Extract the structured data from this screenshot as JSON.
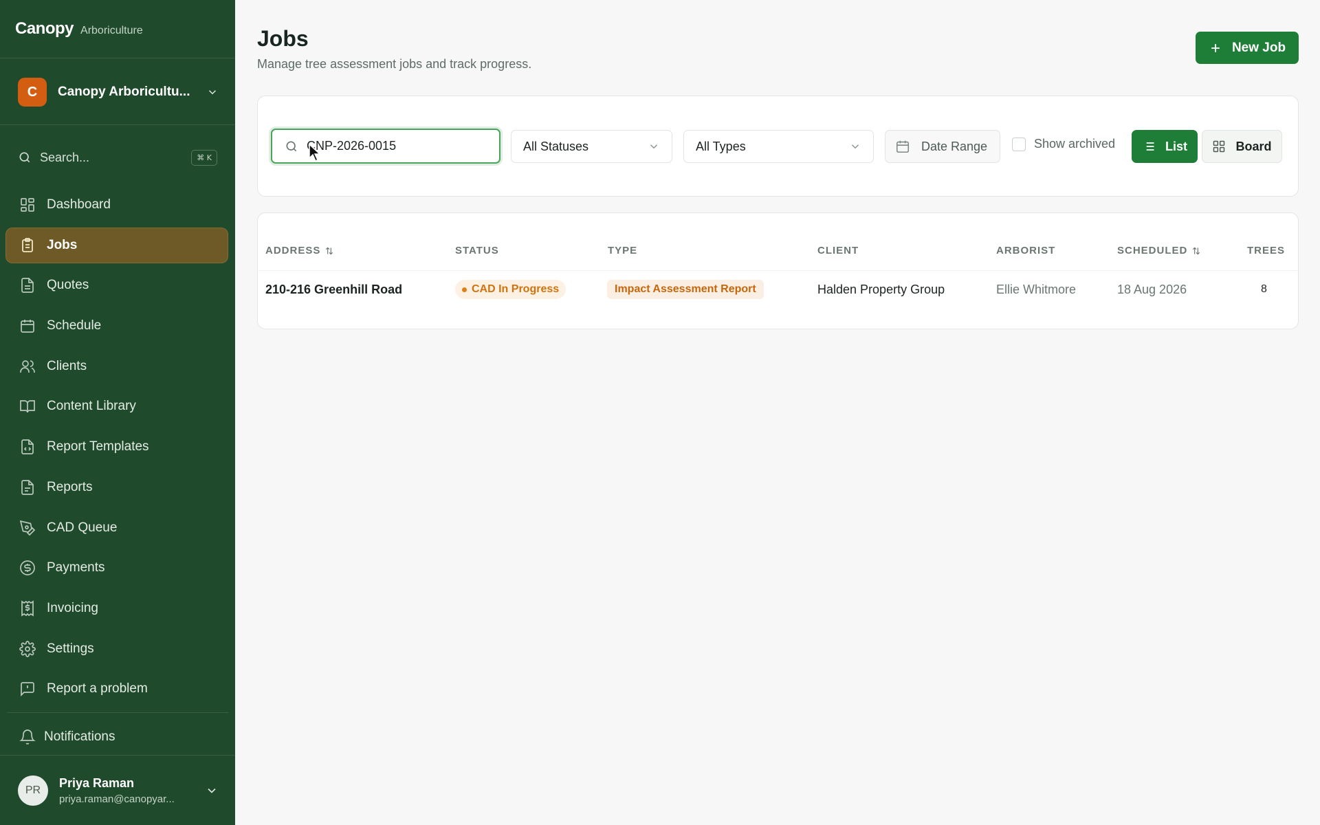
{
  "brand": {
    "name": "Canopy",
    "subtitle": "Arboriculture"
  },
  "org": {
    "initial": "C",
    "name": "Canopy Arboricultu..."
  },
  "sidebar_search": {
    "label": "Search...",
    "shortcut": "⌘ K"
  },
  "nav": {
    "items": [
      {
        "label": "Dashboard",
        "icon": "dashboard-icon"
      },
      {
        "label": "Jobs",
        "icon": "clipboard-icon",
        "active": true
      },
      {
        "label": "Quotes",
        "icon": "document-icon"
      },
      {
        "label": "Schedule",
        "icon": "calendar-icon"
      },
      {
        "label": "Clients",
        "icon": "users-icon"
      },
      {
        "label": "Content Library",
        "icon": "book-icon"
      },
      {
        "label": "Report Templates",
        "icon": "file-code-icon"
      },
      {
        "label": "Reports",
        "icon": "file-text-icon"
      },
      {
        "label": "CAD Queue",
        "icon": "pen-tool-icon"
      },
      {
        "label": "Payments",
        "icon": "dollar-circle-icon"
      },
      {
        "label": "Invoicing",
        "icon": "receipt-icon"
      },
      {
        "label": "Settings",
        "icon": "gear-icon"
      },
      {
        "label": "Report a problem",
        "icon": "message-alert-icon"
      }
    ]
  },
  "notifications": {
    "label": "Notifications"
  },
  "user": {
    "initials": "PR",
    "name": "Priya Raman",
    "email": "priya.raman@canopyar..."
  },
  "header": {
    "title": "Jobs",
    "subtitle": "Manage tree assessment jobs and track progress.",
    "new_job_label": "New Job"
  },
  "filters": {
    "search_value": "CNP-2026-0015",
    "status": "All Statuses",
    "type": "All Types",
    "date_range": "Date Range",
    "show_archived": "Show archived",
    "view_list": "List",
    "view_board": "Board"
  },
  "table": {
    "columns": [
      "ADDRESS",
      "STATUS",
      "TYPE",
      "CLIENT",
      "ARBORIST",
      "SCHEDULED",
      "TREES"
    ],
    "rows": [
      {
        "address": "210-216 Greenhill Road",
        "status": "CAD In Progress",
        "type": "Impact Assessment Report",
        "client": "Halden Property Group",
        "arborist": "Ellie Whitmore",
        "scheduled": "18 Aug 2026",
        "trees": "8"
      }
    ]
  },
  "colors": {
    "sidebar_bg": "#1f4a2b",
    "active_nav_bg": "#6e5a26",
    "primary_button": "#1e7d37",
    "status_orange": "#d0730e",
    "org_avatar": "#d35e12"
  }
}
